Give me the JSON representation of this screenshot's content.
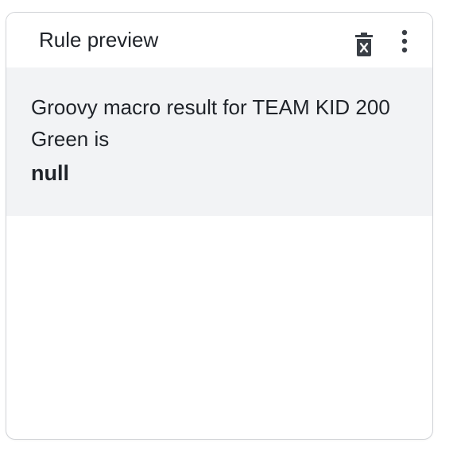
{
  "card": {
    "title": "Rule preview",
    "actions": {
      "delete_icon": "trash-x-icon",
      "more_icon": "more-vertical-icon"
    },
    "preview": {
      "message": "Groovy macro result for TEAM KID 200 Green is",
      "value": "null"
    }
  },
  "colors": {
    "text": "#1f2329",
    "preview_background": "#f2f3f5",
    "border": "#d2d4d8",
    "icon": "#3a3f46"
  }
}
